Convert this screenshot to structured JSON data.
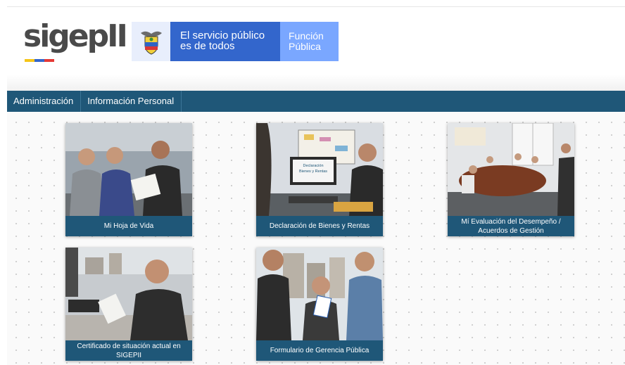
{
  "header": {
    "logo_text": "sigepII",
    "gov_line1": "El servicio público",
    "gov_line2": "es de todos",
    "fp_line1": "Función",
    "fp_line2": "Pública",
    "brand_blue": "#3366cc",
    "brand_light_blue": "#7aa7ff"
  },
  "nav": {
    "items": [
      {
        "label": "Administración"
      },
      {
        "label": "Información Personal"
      }
    ],
    "bg_color": "#1f5778"
  },
  "tiles": [
    {
      "caption": "Mi Hoja de Vida"
    },
    {
      "caption": "Declaración de Bienes y Rentas",
      "photo_sign_line1": "Declaración",
      "photo_sign_line2": "Bienes y Rentas"
    },
    {
      "caption": "Mí Evaluación del Desempeño / Acuerdos de Gestión"
    },
    {
      "caption": "Certificado de situación actual en SIGEPII"
    },
    {
      "caption": "Formulario de Gerencia Pública"
    }
  ]
}
